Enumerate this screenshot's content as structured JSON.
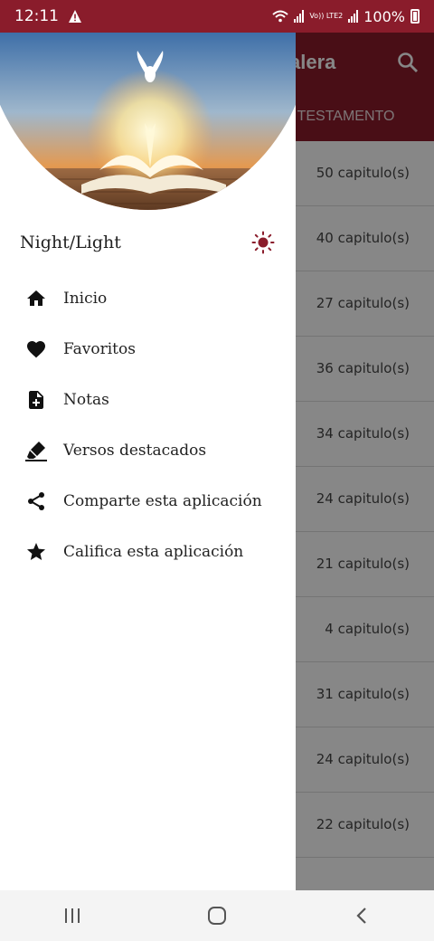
{
  "status_bar": {
    "time": "12:11",
    "lte_label": "Vo)) LTE2",
    "battery": "100%"
  },
  "app": {
    "title_fragment": "alera",
    "tab_fragment": "O TESTAMENTO",
    "chapters": [
      "50 capitulo(s)",
      "40 capitulo(s)",
      "27 capitulo(s)",
      "36 capitulo(s)",
      "34 capitulo(s)",
      "24 capitulo(s)",
      "21 capitulo(s)",
      "4 capitulo(s)",
      "31 capitulo(s)",
      "24 capitulo(s)",
      "22 capitulo(s)",
      ""
    ]
  },
  "drawer": {
    "mode_label": "Night/Light",
    "mode_icon": "sun-icon",
    "items": [
      {
        "label": "Inicio",
        "icon": "home-icon"
      },
      {
        "label": "Favoritos",
        "icon": "heart-icon"
      },
      {
        "label": "Notas",
        "icon": "note-add-icon"
      },
      {
        "label": "Versos destacados",
        "icon": "highlighter-icon"
      },
      {
        "label": "Comparte esta aplicación",
        "icon": "share-icon"
      },
      {
        "label": "Califica esta aplicación",
        "icon": "star-icon"
      }
    ]
  },
  "nav_bar": {
    "buttons": [
      "recent-apps-icon",
      "home-circle-icon",
      "back-icon"
    ]
  },
  "colors": {
    "primary": "#8a1c2b",
    "scrim": "rgba(0,0,0,0.47)",
    "accent_icon": "#8a1c2b"
  }
}
